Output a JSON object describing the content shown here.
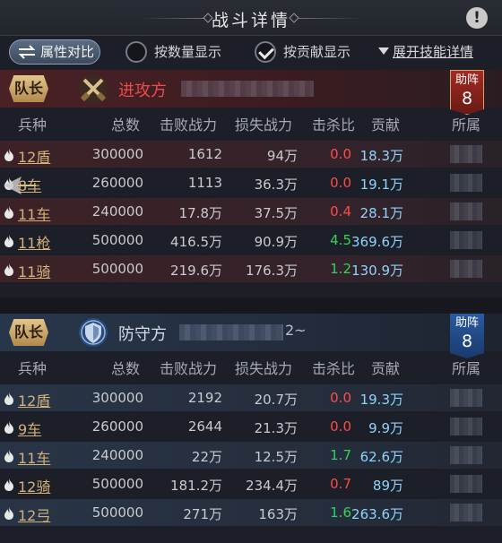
{
  "header": {
    "title": "战斗详情",
    "info_icon": "!"
  },
  "toolbar": {
    "compare_label": "属性对比",
    "by_quantity_label": "按数量显示",
    "by_contribution_label": "按贡献显示",
    "expand_label": "展开技能详情"
  },
  "columns": [
    "兵种",
    "总数",
    "击败战力",
    "损失战力",
    "击杀比",
    "贡献",
    "所属"
  ],
  "attacker": {
    "leader_badge": "队长",
    "side_name": "进攻方",
    "assist_label": "助阵",
    "assist_count": "8",
    "rows": [
      {
        "unit": "12盾",
        "total": "300000",
        "defeated": "1612",
        "lost": "94万",
        "ratio": "0.0",
        "ratio_color": "red",
        "contribution": "18.3万"
      },
      {
        "unit": "8车",
        "total": "260000",
        "defeated": "1113",
        "lost": "36.3万",
        "ratio": "0.0",
        "ratio_color": "red",
        "contribution": "19.1万"
      },
      {
        "unit": "11车",
        "total": "240000",
        "defeated": "17.8万",
        "lost": "37.5万",
        "ratio": "0.4",
        "ratio_color": "red",
        "contribution": "28.1万"
      },
      {
        "unit": "11枪",
        "total": "500000",
        "defeated": "416.5万",
        "lost": "90.9万",
        "ratio": "4.5",
        "ratio_color": "green",
        "contribution": "369.6万"
      },
      {
        "unit": "11骑",
        "total": "500000",
        "defeated": "219.6万",
        "lost": "176.3万",
        "ratio": "1.2",
        "ratio_color": "green",
        "contribution": "130.9万"
      }
    ]
  },
  "defender": {
    "leader_badge": "队长",
    "side_name": "防守方",
    "name_tail": "2~",
    "assist_label": "助阵",
    "assist_count": "8",
    "rows": [
      {
        "unit": "12盾",
        "total": "300000",
        "defeated": "2192",
        "lost": "20.7万",
        "ratio": "0.0",
        "ratio_color": "red",
        "contribution": "19.3万"
      },
      {
        "unit": "9车",
        "total": "260000",
        "defeated": "2644",
        "lost": "21.3万",
        "ratio": "0.0",
        "ratio_color": "red",
        "contribution": "9.9万"
      },
      {
        "unit": "11车",
        "total": "240000",
        "defeated": "22万",
        "lost": "12.5万",
        "ratio": "1.7",
        "ratio_color": "green",
        "contribution": "62.6万"
      },
      {
        "unit": "12骑",
        "total": "500000",
        "defeated": "181.2万",
        "lost": "234.4万",
        "ratio": "0.7",
        "ratio_color": "red",
        "contribution": "89万"
      },
      {
        "unit": "12弓",
        "total": "500000",
        "defeated": "271万",
        "lost": "163万",
        "ratio": "1.6",
        "ratio_color": "green",
        "contribution": "263.6万"
      }
    ]
  },
  "colors": {
    "red": "#ff4a4a",
    "green": "#35d15a",
    "contribution": "#8fd2ff",
    "unit_gold": "#d2b07a"
  }
}
